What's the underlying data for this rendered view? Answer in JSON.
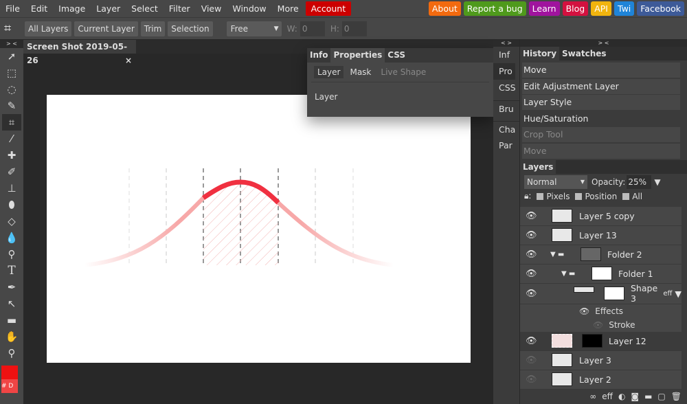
{
  "menu": [
    "File",
    "Edit",
    "Image",
    "Layer",
    "Select",
    "Filter",
    "View",
    "Window",
    "More"
  ],
  "account": "Account",
  "links": [
    {
      "label": "About",
      "color": "#f26a0f"
    },
    {
      "label": "Report a bug",
      "color": "#4f9a1c"
    },
    {
      "label": "Learn",
      "color": "#a0139e"
    },
    {
      "label": "Blog",
      "color": "#d3113f"
    },
    {
      "label": "API",
      "color": "#f1b40e"
    },
    {
      "label": "Twi",
      "color": "#1f84d8"
    },
    {
      "label": "Facebook",
      "color": "#3d5a98"
    }
  ],
  "toolbar": {
    "buttons": [
      "All Layers",
      "Current Layer",
      "Trim",
      "Selection"
    ],
    "ratio": "Free",
    "w_label": "W:",
    "w_value": "0",
    "h_label": "H:",
    "h_value": "0"
  },
  "doc_tab": {
    "title": "Screen Shot 2019-05-26",
    "close": "×"
  },
  "properties": {
    "tabs": [
      "Info",
      "Properties",
      "CSS"
    ],
    "subtabs": [
      "Layer",
      "Mask",
      "Live Shape"
    ],
    "content": "Layer"
  },
  "mini_panels": [
    "Inf",
    "Pro",
    "CSS",
    "Bru",
    "Cha",
    "Par"
  ],
  "collapse": {
    "left": "> <",
    "mid": "< >",
    "right": "> <"
  },
  "history": {
    "tabs": [
      "History",
      "Swatches"
    ],
    "items": [
      "Move",
      "Edit Adjustment Layer",
      "Layer Style",
      "Hue/Saturation",
      "Crop Tool",
      "Move"
    ]
  },
  "layers": {
    "tab": "Layers",
    "blend": "Normal",
    "opacity_label": "Opacity:",
    "opacity": "25%",
    "lock": [
      "Pixels",
      "Position",
      "All"
    ],
    "items": [
      "Layer 5 copy",
      "Layer 13",
      "Folder 2",
      "Folder 1",
      "Shape 3",
      "Effects",
      "Stroke",
      "Layer 12",
      "Layer 3",
      "Layer 2"
    ],
    "eff": "eff",
    "footer_eff": "eff"
  },
  "colors": {
    "foreground": "#ee1111",
    "background": "#f04545",
    "fg_label": "#",
    "bg_label": "D"
  }
}
